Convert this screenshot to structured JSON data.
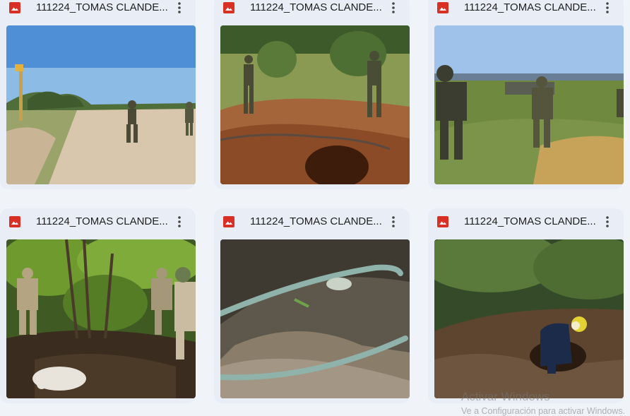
{
  "files": [
    {
      "name": "111224_TOMAS CLANDE..."
    },
    {
      "name": "111224_TOMAS CLANDE..."
    },
    {
      "name": "111224_TOMAS CLANDE..."
    },
    {
      "name": "111224_TOMAS CLANDE..."
    },
    {
      "name": "111224_TOMAS CLANDE..."
    },
    {
      "name": "111224_TOMAS CLANDE..."
    }
  ],
  "file_icon": "image-file-icon",
  "more_icon": "more-vertical-icon",
  "colors": {
    "image_icon": "#d93025",
    "card_bg": "#e9eef6",
    "page_bg": "#f0f4f9"
  },
  "watermark": {
    "line1": "Activar Windows",
    "line2": "Ve a Configuración para activar Windows."
  }
}
